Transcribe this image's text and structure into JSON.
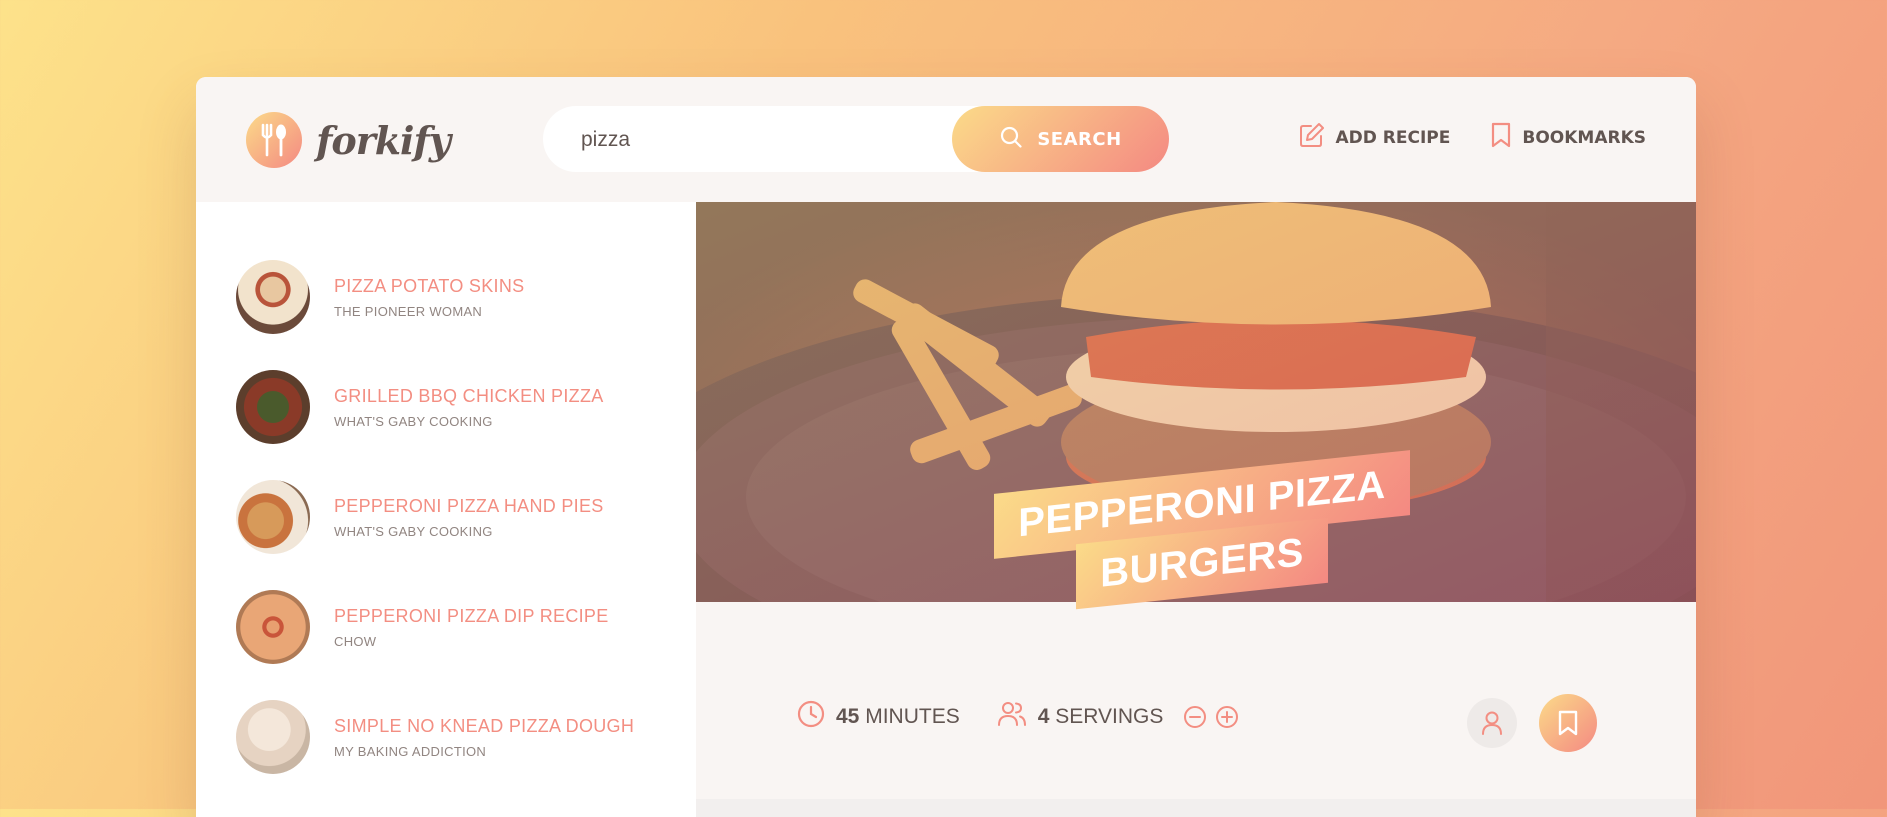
{
  "app": {
    "logo_text": "forkify"
  },
  "search": {
    "value": "pizza",
    "button_label": "SEARCH"
  },
  "nav": {
    "add_recipe": "ADD RECIPE",
    "bookmarks": "BOOKMARKS"
  },
  "results": [
    {
      "title": "PIZZA POTATO SKINS",
      "publisher": "THE PIONEER WOMAN"
    },
    {
      "title": "GRILLED BBQ CHICKEN PIZZA",
      "publisher": "WHAT'S GABY COOKING"
    },
    {
      "title": "PEPPERONI PIZZA HAND PIES",
      "publisher": "WHAT'S GABY COOKING"
    },
    {
      "title": "PEPPERONI PIZZA DIP RECIPE",
      "publisher": "CHOW"
    },
    {
      "title": "SIMPLE NO KNEAD PIZZA DOUGH",
      "publisher": "MY BAKING ADDICTION"
    }
  ],
  "recipe": {
    "title_line1": "PEPPERONI PIZZA",
    "title_line2": "BURGERS",
    "minutes": "45",
    "minutes_label": "MINUTES",
    "servings": "4",
    "servings_label": "SERVINGS"
  },
  "colors": {
    "accent_start": "#fbdb89",
    "accent_end": "#f48982",
    "text": "#615551",
    "accent_text": "#f38e82"
  },
  "icons": [
    "fork-spoon-icon",
    "search-icon",
    "edit-icon",
    "bookmark-icon",
    "clock-icon",
    "users-icon",
    "minus-circle-icon",
    "plus-circle-icon",
    "user-icon",
    "bookmark-fill-icon"
  ]
}
